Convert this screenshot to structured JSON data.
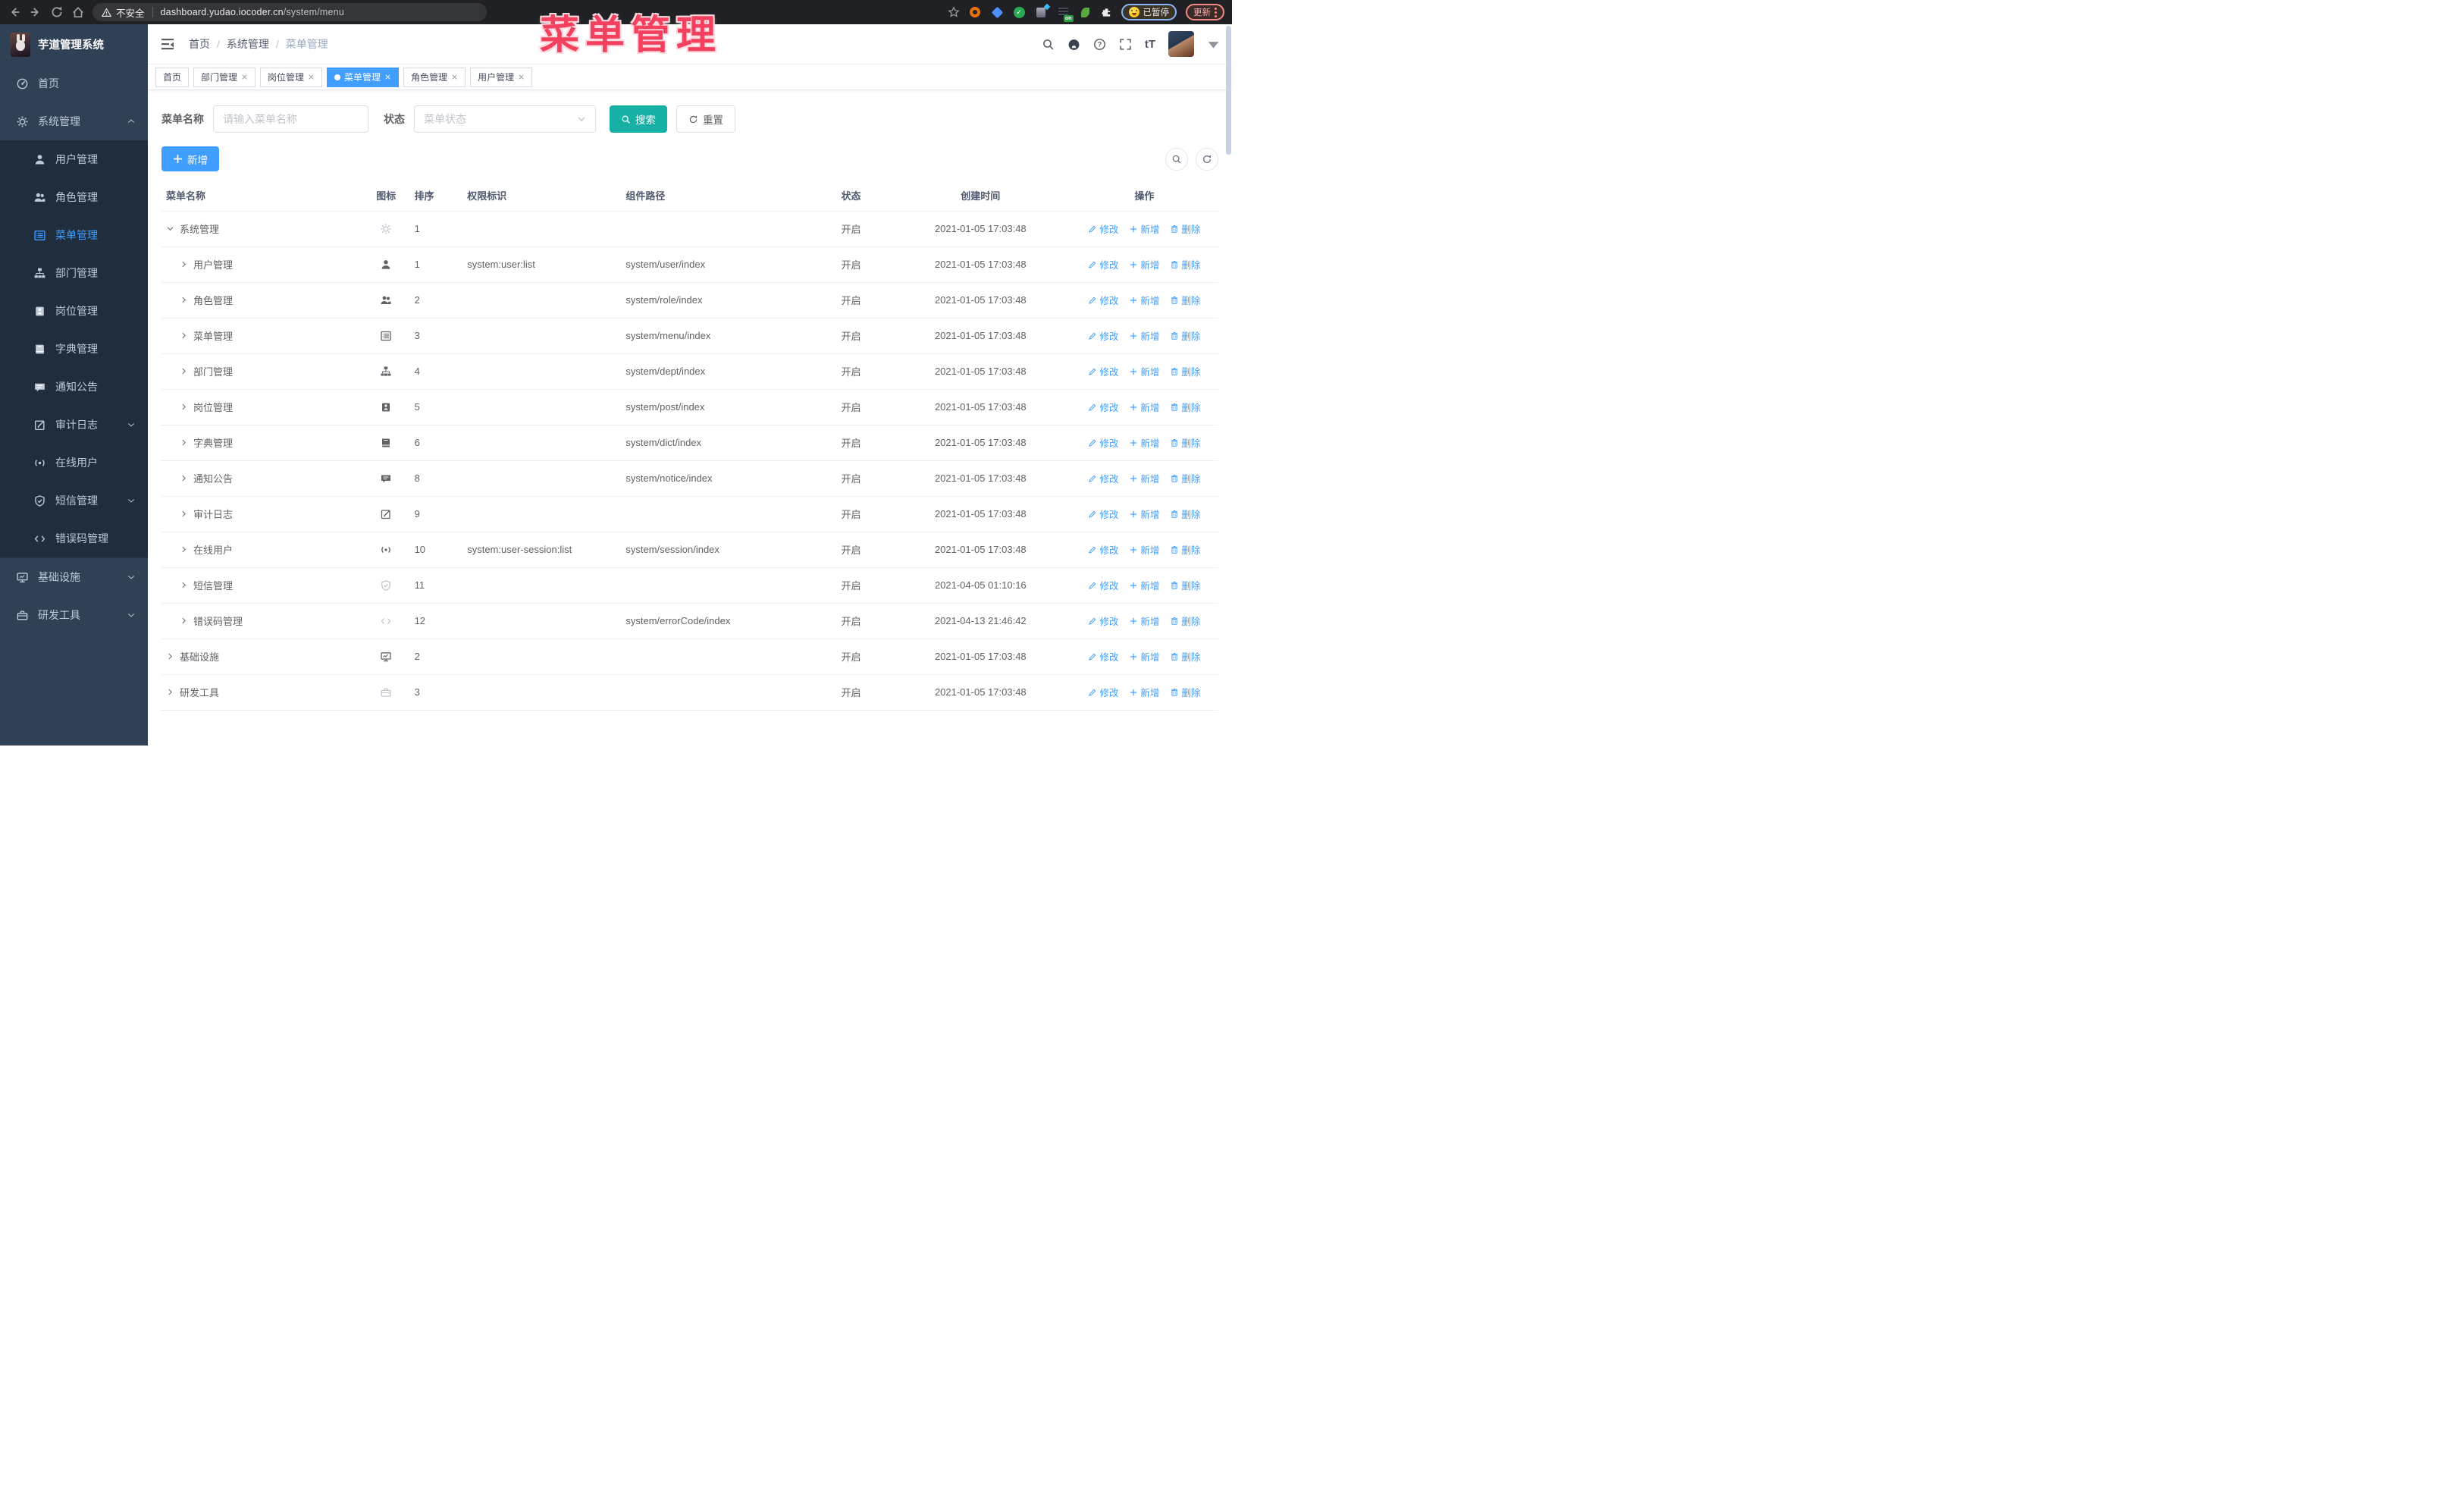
{
  "browser": {
    "security_label": "不安全",
    "url_host": "dashboard.yudao.iocoder.cn",
    "url_path": "/system/menu",
    "extension_badge": "on",
    "paused_label": "已暂停",
    "update_label": "更新",
    "accent_colors": {
      "paused_border": "#8ab4f8",
      "update_border": "#f28b82"
    }
  },
  "overlay": {
    "text": "菜单管理"
  },
  "app": {
    "title": "芋道管理系统"
  },
  "breadcrumb": {
    "items": [
      "首页",
      "系统管理",
      "菜单管理"
    ]
  },
  "tags": [
    {
      "label": "首页",
      "closable": false,
      "active": false
    },
    {
      "label": "部门管理",
      "closable": true,
      "active": false
    },
    {
      "label": "岗位管理",
      "closable": true,
      "active": false
    },
    {
      "label": "菜单管理",
      "closable": true,
      "active": true
    },
    {
      "label": "角色管理",
      "closable": true,
      "active": false
    },
    {
      "label": "用户管理",
      "closable": true,
      "active": false
    }
  ],
  "sidebar": {
    "items": [
      {
        "label": "首页",
        "icon": "dashboard",
        "chevron": null
      },
      {
        "label": "系统管理",
        "icon": "gear",
        "chevron": "up",
        "children": [
          {
            "label": "用户管理",
            "icon": "user"
          },
          {
            "label": "角色管理",
            "icon": "users"
          },
          {
            "label": "菜单管理",
            "icon": "menu",
            "active": true
          },
          {
            "label": "部门管理",
            "icon": "tree"
          },
          {
            "label": "岗位管理",
            "icon": "post"
          },
          {
            "label": "字典管理",
            "icon": "dict"
          },
          {
            "label": "通知公告",
            "icon": "message"
          },
          {
            "label": "审计日志",
            "icon": "edit",
            "chevron": "down"
          },
          {
            "label": "在线用户",
            "icon": "online"
          },
          {
            "label": "短信管理",
            "icon": "shield",
            "chevron": "down"
          },
          {
            "label": "错误码管理",
            "icon": "code"
          }
        ]
      },
      {
        "label": "基础设施",
        "icon": "monitor",
        "chevron": "down",
        "divider": true
      },
      {
        "label": "研发工具",
        "icon": "toolbox",
        "chevron": "down"
      }
    ]
  },
  "search": {
    "name_label": "菜单名称",
    "name_placeholder": "请输入菜单名称",
    "status_label": "状态",
    "status_placeholder": "菜单状态",
    "search_label": "搜索",
    "reset_label": "重置"
  },
  "toolbar": {
    "add_label": "新增"
  },
  "table": {
    "headers": [
      "菜单名称",
      "图标",
      "排序",
      "权限标识",
      "组件路径",
      "状态",
      "创建时间",
      "操作"
    ],
    "action_labels": [
      "修改",
      "新增",
      "删除"
    ],
    "status_on": "开启",
    "rows": [
      {
        "name": "系统管理",
        "icon": "gear",
        "muted": true,
        "level": 0,
        "expanded": true,
        "sort": "1",
        "perm": "",
        "path": "",
        "status": "开启",
        "time": "2021-01-05 17:03:48"
      },
      {
        "name": "用户管理",
        "icon": "user",
        "muted": false,
        "level": 1,
        "expanded": false,
        "sort": "1",
        "perm": "system:user:list",
        "path": "system/user/index",
        "status": "开启",
        "time": "2021-01-05 17:03:48"
      },
      {
        "name": "角色管理",
        "icon": "users",
        "muted": false,
        "level": 1,
        "expanded": false,
        "sort": "2",
        "perm": "",
        "path": "system/role/index",
        "status": "开启",
        "time": "2021-01-05 17:03:48"
      },
      {
        "name": "菜单管理",
        "icon": "menu",
        "muted": false,
        "level": 1,
        "expanded": false,
        "sort": "3",
        "perm": "",
        "path": "system/menu/index",
        "status": "开启",
        "time": "2021-01-05 17:03:48"
      },
      {
        "name": "部门管理",
        "icon": "tree",
        "muted": false,
        "level": 1,
        "expanded": false,
        "sort": "4",
        "perm": "",
        "path": "system/dept/index",
        "status": "开启",
        "time": "2021-01-05 17:03:48"
      },
      {
        "name": "岗位管理",
        "icon": "post",
        "muted": false,
        "level": 1,
        "expanded": false,
        "sort": "5",
        "perm": "",
        "path": "system/post/index",
        "status": "开启",
        "time": "2021-01-05 17:03:48"
      },
      {
        "name": "字典管理",
        "icon": "dict",
        "muted": false,
        "level": 1,
        "expanded": false,
        "sort": "6",
        "perm": "",
        "path": "system/dict/index",
        "status": "开启",
        "time": "2021-01-05 17:03:48"
      },
      {
        "name": "通知公告",
        "icon": "message",
        "muted": false,
        "level": 1,
        "expanded": false,
        "sort": "8",
        "perm": "",
        "path": "system/notice/index",
        "status": "开启",
        "time": "2021-01-05 17:03:48"
      },
      {
        "name": "审计日志",
        "icon": "edit",
        "muted": false,
        "level": 1,
        "expanded": false,
        "sort": "9",
        "perm": "",
        "path": "",
        "status": "开启",
        "time": "2021-01-05 17:03:48"
      },
      {
        "name": "在线用户",
        "icon": "online",
        "muted": false,
        "level": 1,
        "expanded": false,
        "sort": "10",
        "perm": "system:user-session:list",
        "path": "system/session/index",
        "status": "开启",
        "time": "2021-01-05 17:03:48"
      },
      {
        "name": "短信管理",
        "icon": "shield",
        "muted": true,
        "level": 1,
        "expanded": false,
        "sort": "11",
        "perm": "",
        "path": "",
        "status": "开启",
        "time": "2021-04-05 01:10:16"
      },
      {
        "name": "错误码管理",
        "icon": "code",
        "muted": true,
        "level": 1,
        "expanded": false,
        "sort": "12",
        "perm": "",
        "path": "system/errorCode/index",
        "status": "开启",
        "time": "2021-04-13 21:46:42"
      },
      {
        "name": "基础设施",
        "icon": "monitor",
        "muted": false,
        "level": 0,
        "expanded": false,
        "sort": "2",
        "perm": "",
        "path": "",
        "status": "开启",
        "time": "2021-01-05 17:03:48"
      },
      {
        "name": "研发工具",
        "icon": "toolbox",
        "muted": true,
        "level": 0,
        "expanded": false,
        "sort": "3",
        "perm": "",
        "path": "",
        "status": "开启",
        "time": "2021-01-05 17:03:48"
      }
    ]
  }
}
